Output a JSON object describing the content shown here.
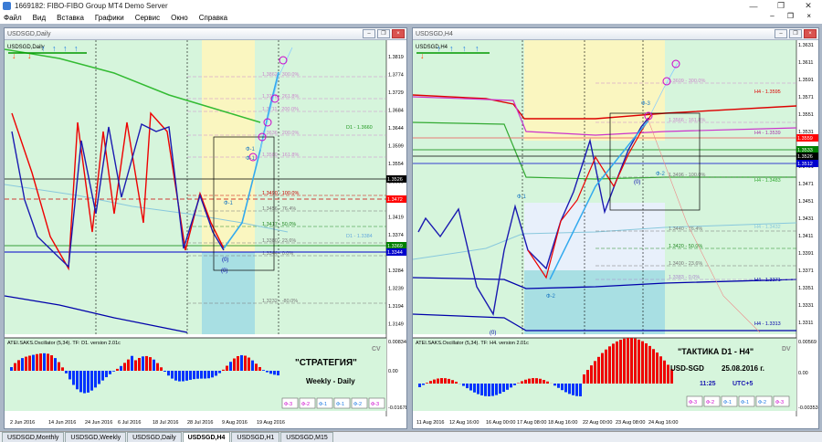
{
  "app": {
    "title": "1669182: FIBO-FIBO Group MT4 Demo Server"
  },
  "menu": [
    "Файл",
    "Вид",
    "Вставка",
    "Графики",
    "Сервис",
    "Окно",
    "Справка"
  ],
  "left": {
    "window_title": "USDSGD,Daily",
    "symbol": "USDSGD,Daily",
    "price_scale": [
      "1.3819",
      "1.3774",
      "1.3729",
      "1.3684",
      "1.3644",
      "1.3599",
      "1.3554",
      "1.3509",
      "1.3464",
      "1.3419",
      "1.3374",
      "1.3329",
      "1.3284",
      "1.3239",
      "1.3194",
      "1.3149"
    ],
    "price_boxes": [
      {
        "text": "1.3526",
        "color": "#000000"
      },
      {
        "text": "1.3472",
        "color": "#ff0000"
      },
      {
        "text": "1.3369",
        "color": "#008000"
      },
      {
        "text": "1.3344",
        "color": "#0000cc"
      }
    ],
    "fib_labels": [
      "1.3862 - 300.0%",
      "1.3776 - 261.8%",
      "1.3711 - 200.0%",
      "1.3636 - 200.0%",
      "1.3580 - 161.8%",
      "1.3490 - 100.0%",
      "1.3456 - 76.4%",
      "1.3417 - 50.0%",
      "1.3380 - 23.6%",
      "1.3344 - 0.0%",
      "1.3232 - -80.0%"
    ],
    "line_labels": [
      "D1 - 1.3660",
      "D1 - 1.3384"
    ],
    "marks": [
      "Ф-1",
      "Ф-1",
      "Ф-1",
      "(0)",
      "(0)"
    ],
    "osc_label": "ATEI.SAKS.Oscillator (5,34). TF: D1. version 2.01c",
    "osc_scale": [
      "0.00834",
      "0.00",
      "-0.01678"
    ],
    "cv": "CV",
    "strategy_title": "\"СТРАТЕГИЯ\"",
    "strategy_sub": "Weekly - Daily",
    "buttons": [
      "Ф-3",
      "Ф-2",
      "Ф-1",
      "Ф-1",
      "Ф-2",
      "Ф-3"
    ],
    "dates": [
      "2 Jun 2016",
      "14 Jun 2016",
      "24 Jun 2016",
      "6 Jul 2016",
      "18 Jul 2016",
      "28 Jul 2016",
      "9 Aug 2016",
      "19 Aug 2016"
    ]
  },
  "right": {
    "window_title": "USDSGD,H4",
    "symbol": "USDSGD,H4",
    "price_scale": [
      "1.3631",
      "1.3611",
      "1.3591",
      "1.3571",
      "1.3551",
      "1.3531",
      "1.3511",
      "1.3491",
      "1.3471",
      "1.3451",
      "1.3431",
      "1.3411",
      "1.3391",
      "1.3371",
      "1.3351",
      "1.3331",
      "1.3311"
    ],
    "price_boxes": [
      {
        "text": "1.3559",
        "color": "#ff0000"
      },
      {
        "text": "1.3533",
        "color": "#008000"
      },
      {
        "text": "1.3526",
        "color": "#000000"
      },
      {
        "text": "1.3512",
        "color": "#0000cc"
      }
    ],
    "fib_labels": [
      "1.3609 - 300.0%",
      "1.3566 - 161.8%",
      "1.3496 - 100.0%",
      "1.3440 - 76.4%",
      "1.3420 - 50.0%",
      "1.3400 - 23.6%",
      "1.3383 - 0.0%"
    ],
    "line_labels": [
      "H4 - 1.3595",
      "H4 - 1.3539",
      "H4 - 1.3483",
      "H4 - 1.3371",
      "H4 - 1.3313",
      "H4 - 1.3432"
    ],
    "marks": [
      "Ф-3",
      "Ф-1",
      "Ф-2",
      "Ф-2",
      "(0)",
      "(0)"
    ],
    "osc_label": "ATEI.SAKS.Oscillator (5,34). TF: H4. version 2.01c",
    "osc_scale": [
      "0.00569",
      "0.00",
      "-0.00353"
    ],
    "dv": "DV",
    "tactic_title": "\"ТАКТИКА  D1 - H4\"",
    "pair": "USD-SGD",
    "date": "25.08.2016 г.",
    "time": "11:25",
    "tz": "UTC+5",
    "buttons": [
      "Ф-3",
      "Ф-2",
      "Ф-1",
      "Ф-1",
      "Ф-2",
      "Ф-3"
    ],
    "dates": [
      "11 Aug 2016",
      "12 Aug 16:00",
      "16 Aug 00:00",
      "17 Aug 08:00",
      "18 Aug 16:00",
      "22 Aug 00:00",
      "23 Aug 08:00",
      "24 Aug 16:00"
    ]
  },
  "tabs": [
    "USDSGD,Monthly",
    "USDSGD,Weekly",
    "USDSGD,Daily",
    "USDSGD,H4",
    "USDSGD,H1",
    "USDSGD,M15"
  ],
  "active_tab": 3
}
